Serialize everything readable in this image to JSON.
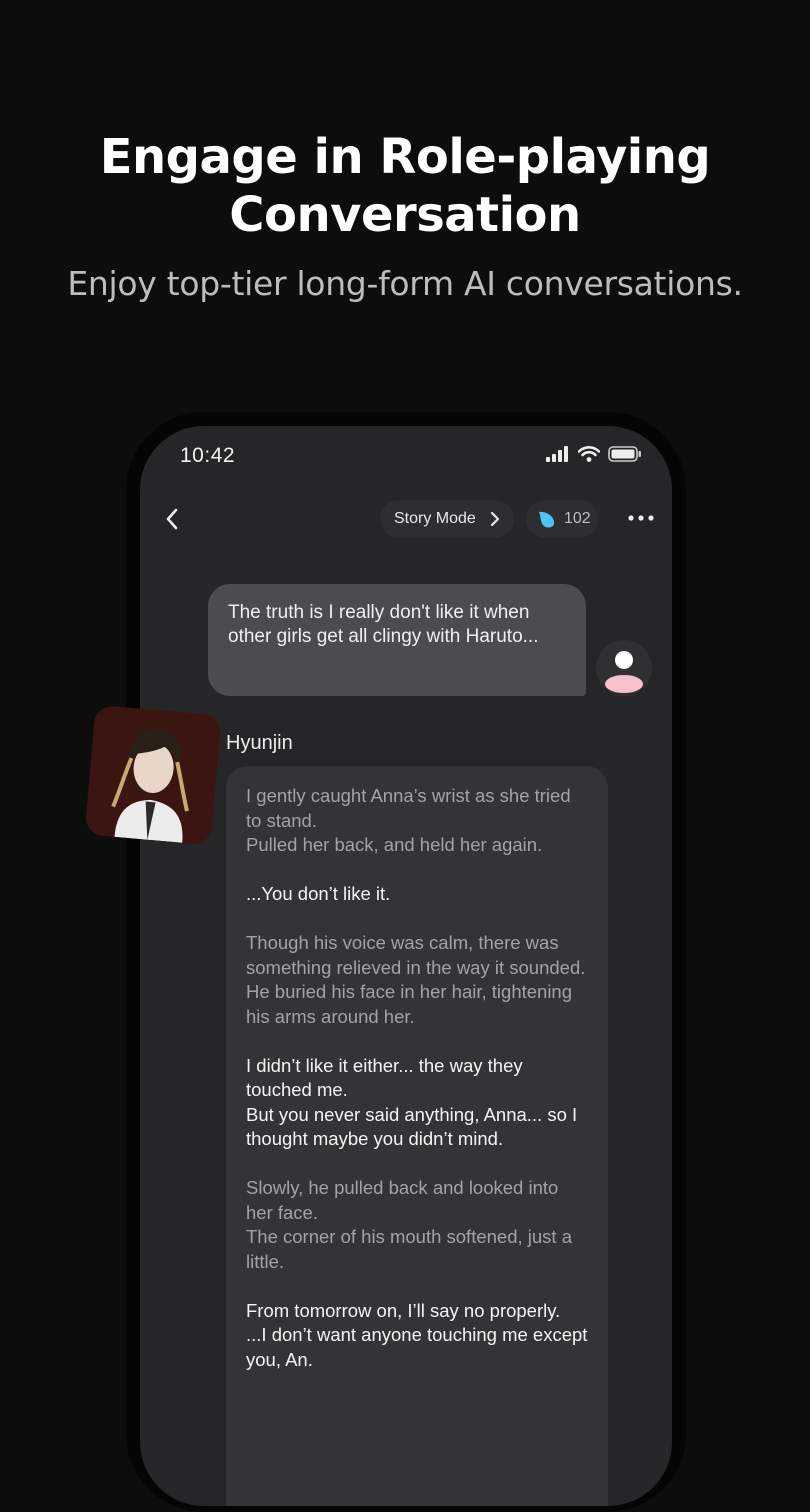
{
  "hero": {
    "title_line1": "Engage in Role-playing",
    "title_line2": "Conversation",
    "subtitle": "Enjoy top-tier long-form AI conversations."
  },
  "status_bar": {
    "time": "10:42"
  },
  "chat_header": {
    "mode_label": "Story Mode",
    "token_count": "102",
    "token_color": "#4fc3f7"
  },
  "messages": {
    "user_message": "The truth is I really don't like it when other girls get all clingy with Haruto...",
    "character_name": "Hyunjin",
    "character_paragraphs": [
      {
        "type": "narration",
        "text": "I gently caught Anna’s wrist as she tried to stand.\nPulled her back, and held her again."
      },
      {
        "type": "dialogue",
        "text": "...You don’t like it."
      },
      {
        "type": "narration",
        "text": "Though his voice was calm, there was something relieved in the way it sounded.\nHe buried his face in her hair, tightening his arms around her."
      },
      {
        "type": "dialogue",
        "text": "I didn’t like it either... the way they touched me.\nBut you never said anything, Anna... so I thought maybe you didn’t mind."
      },
      {
        "type": "narration",
        "text": "Slowly, he pulled back and looked into her face.\n The corner of his mouth softened, just a little."
      },
      {
        "type": "dialogue",
        "text": "From tomorrow on, I’ll say no properly.\n ...I don’t want anyone touching me except you, An."
      }
    ]
  }
}
